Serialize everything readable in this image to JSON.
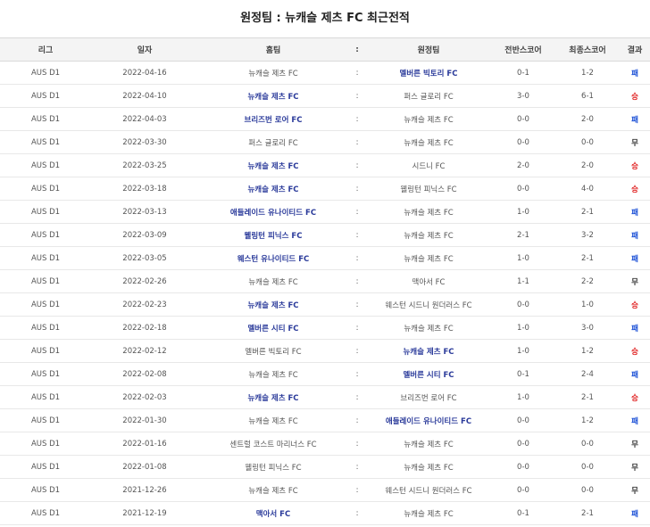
{
  "title": "원정팀 : 뉴캐슬 제츠 FC 최근전적",
  "headers": {
    "league": "리그",
    "date": "일자",
    "home": "홈팀",
    "sep": ":",
    "away": "원정팀",
    "half_score": "전반스코어",
    "final_score": "최종스코어",
    "result": "결과"
  },
  "colors": {
    "header_bg": "#f4f4f4",
    "bold_team": "#2a3a9a",
    "loss": "#1a4fd6",
    "win": "#e02020",
    "draw": "#333333"
  },
  "rows": [
    {
      "league": "AUS D1",
      "date": "2022-04-16",
      "home": "뉴캐슬 제츠 FC",
      "home_bold": false,
      "sep": ":",
      "away": "멜버른 빅토리 FC",
      "away_bold": true,
      "half": "0-1",
      "final": "1-2",
      "result": "패",
      "result_type": "loss"
    },
    {
      "league": "AUS D1",
      "date": "2022-04-10",
      "home": "뉴캐슬 제츠 FC",
      "home_bold": true,
      "sep": ":",
      "away": "퍼스 글로리 FC",
      "away_bold": false,
      "half": "3-0",
      "final": "6-1",
      "result": "승",
      "result_type": "win"
    },
    {
      "league": "AUS D1",
      "date": "2022-04-03",
      "home": "브리즈번 로어 FC",
      "home_bold": true,
      "sep": ":",
      "away": "뉴캐슬 제츠 FC",
      "away_bold": false,
      "half": "0-0",
      "final": "2-0",
      "result": "패",
      "result_type": "loss"
    },
    {
      "league": "AUS D1",
      "date": "2022-03-30",
      "home": "퍼스 글로리 FC",
      "home_bold": false,
      "sep": ":",
      "away": "뉴캐슬 제츠 FC",
      "away_bold": false,
      "half": "0-0",
      "final": "0-0",
      "result": "무",
      "result_type": "draw"
    },
    {
      "league": "AUS D1",
      "date": "2022-03-25",
      "home": "뉴캐슬 제츠 FC",
      "home_bold": true,
      "sep": ":",
      "away": "시드니 FC",
      "away_bold": false,
      "half": "2-0",
      "final": "2-0",
      "result": "승",
      "result_type": "win"
    },
    {
      "league": "AUS D1",
      "date": "2022-03-18",
      "home": "뉴캐슬 제츠 FC",
      "home_bold": true,
      "sep": ":",
      "away": "웰링턴 피닉스 FC",
      "away_bold": false,
      "half": "0-0",
      "final": "4-0",
      "result": "승",
      "result_type": "win"
    },
    {
      "league": "AUS D1",
      "date": "2022-03-13",
      "home": "애들레이드 유나이티드 FC",
      "home_bold": true,
      "sep": ":",
      "away": "뉴캐슬 제츠 FC",
      "away_bold": false,
      "half": "1-0",
      "final": "2-1",
      "result": "패",
      "result_type": "loss"
    },
    {
      "league": "AUS D1",
      "date": "2022-03-09",
      "home": "웰링턴 피닉스 FC",
      "home_bold": true,
      "sep": ":",
      "away": "뉴캐슬 제츠 FC",
      "away_bold": false,
      "half": "2-1",
      "final": "3-2",
      "result": "패",
      "result_type": "loss"
    },
    {
      "league": "AUS D1",
      "date": "2022-03-05",
      "home": "웨스턴 유나이티드 FC",
      "home_bold": true,
      "sep": ":",
      "away": "뉴캐슬 제츠 FC",
      "away_bold": false,
      "half": "1-0",
      "final": "2-1",
      "result": "패",
      "result_type": "loss"
    },
    {
      "league": "AUS D1",
      "date": "2022-02-26",
      "home": "뉴캐슬 제츠 FC",
      "home_bold": false,
      "sep": ":",
      "away": "맥아서 FC",
      "away_bold": false,
      "half": "1-1",
      "final": "2-2",
      "result": "무",
      "result_type": "draw"
    },
    {
      "league": "AUS D1",
      "date": "2022-02-23",
      "home": "뉴캐슬 제츠 FC",
      "home_bold": true,
      "sep": ":",
      "away": "웨스턴 시드니 원더러스 FC",
      "away_bold": false,
      "half": "0-0",
      "final": "1-0",
      "result": "승",
      "result_type": "win"
    },
    {
      "league": "AUS D1",
      "date": "2022-02-18",
      "home": "멜버른 시티 FC",
      "home_bold": true,
      "sep": ":",
      "away": "뉴캐슬 제츠 FC",
      "away_bold": false,
      "half": "1-0",
      "final": "3-0",
      "result": "패",
      "result_type": "loss"
    },
    {
      "league": "AUS D1",
      "date": "2022-02-12",
      "home": "멜버른 빅토리 FC",
      "home_bold": false,
      "sep": ":",
      "away": "뉴캐슬 제츠 FC",
      "away_bold": true,
      "half": "1-0",
      "final": "1-2",
      "result": "승",
      "result_type": "win"
    },
    {
      "league": "AUS D1",
      "date": "2022-02-08",
      "home": "뉴캐슬 제츠 FC",
      "home_bold": false,
      "sep": ":",
      "away": "멜버른 시티 FC",
      "away_bold": true,
      "half": "0-1",
      "final": "2-4",
      "result": "패",
      "result_type": "loss"
    },
    {
      "league": "AUS D1",
      "date": "2022-02-03",
      "home": "뉴캐슬 제츠 FC",
      "home_bold": true,
      "sep": ":",
      "away": "브리즈번 로어 FC",
      "away_bold": false,
      "half": "1-0",
      "final": "2-1",
      "result": "승",
      "result_type": "win"
    },
    {
      "league": "AUS D1",
      "date": "2022-01-30",
      "home": "뉴캐슬 제츠 FC",
      "home_bold": false,
      "sep": ":",
      "away": "애들레이드 유나이티드 FC",
      "away_bold": true,
      "half": "0-0",
      "final": "1-2",
      "result": "패",
      "result_type": "loss"
    },
    {
      "league": "AUS D1",
      "date": "2022-01-16",
      "home": "센트럴 코스트 마리너스 FC",
      "home_bold": false,
      "sep": ":",
      "away": "뉴캐슬 제츠 FC",
      "away_bold": false,
      "half": "0-0",
      "final": "0-0",
      "result": "무",
      "result_type": "draw"
    },
    {
      "league": "AUS D1",
      "date": "2022-01-08",
      "home": "웰링턴 피닉스 FC",
      "home_bold": false,
      "sep": ":",
      "away": "뉴캐슬 제츠 FC",
      "away_bold": false,
      "half": "0-0",
      "final": "0-0",
      "result": "무",
      "result_type": "draw"
    },
    {
      "league": "AUS D1",
      "date": "2021-12-26",
      "home": "뉴캐슬 제츠 FC",
      "home_bold": false,
      "sep": ":",
      "away": "웨스턴 시드니 원더러스 FC",
      "away_bold": false,
      "half": "0-0",
      "final": "0-0",
      "result": "무",
      "result_type": "draw"
    },
    {
      "league": "AUS D1",
      "date": "2021-12-19",
      "home": "맥아서 FC",
      "home_bold": true,
      "sep": ":",
      "away": "뉴캐슬 제츠 FC",
      "away_bold": false,
      "half": "0-1",
      "final": "2-1",
      "result": "패",
      "result_type": "loss"
    }
  ]
}
